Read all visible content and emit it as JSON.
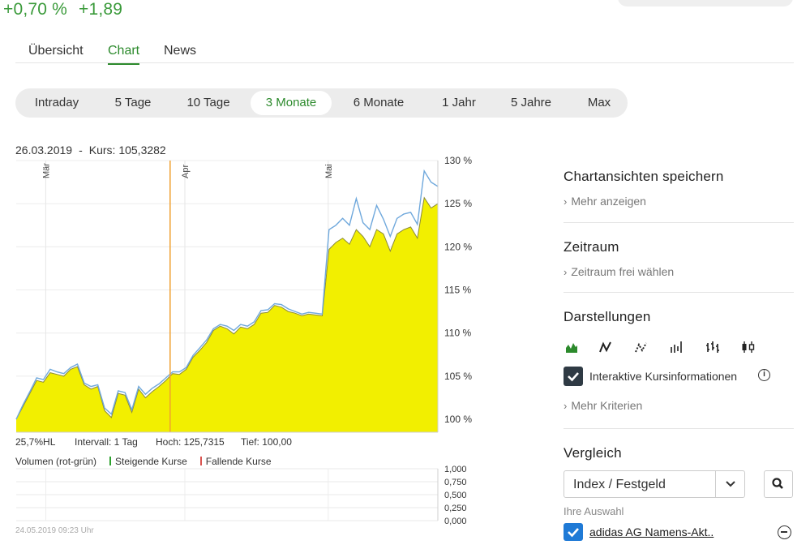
{
  "quote": {
    "change_pct": "+0,70 %",
    "change_abs": "+1,89"
  },
  "tabs": [
    {
      "label": "Übersicht",
      "active": false
    },
    {
      "label": "Chart",
      "active": true
    },
    {
      "label": "News",
      "active": false
    }
  ],
  "ranges": [
    {
      "label": "Intraday",
      "active": false
    },
    {
      "label": "5 Tage",
      "active": false
    },
    {
      "label": "10 Tage",
      "active": false
    },
    {
      "label": "3 Monate",
      "active": true
    },
    {
      "label": "6 Monate",
      "active": false
    },
    {
      "label": "1 Jahr",
      "active": false
    },
    {
      "label": "5 Jahre",
      "active": false
    },
    {
      "label": "Max",
      "active": false
    }
  ],
  "chart_info": {
    "date": "26.03.2019",
    "separator": "-",
    "kurs": "Kurs: 105,3282"
  },
  "stats": {
    "hl": "25,7%HL",
    "interval": "Intervall: 1 Tag",
    "hoch": "Hoch: 125,7315",
    "tief": "Tief: 100,00"
  },
  "volume_legend": {
    "title": "Volumen (rot-grün)",
    "rising": "Steigende Kurse",
    "falling": "Fallende Kurse"
  },
  "timestamp": "24.05.2019 09:23 Uhr",
  "chart_data": [
    {
      "type": "area",
      "x_labels": [
        "Mär",
        "Apr",
        "Mai"
      ],
      "y_ticks": [
        "130 %",
        "125 %",
        "120 %",
        "115 %",
        "110 %",
        "105 %",
        "100 %"
      ],
      "ylim": [
        98.5,
        130
      ],
      "grid": true,
      "crosshair_date": "26.03.2019",
      "month_positions": [
        0.07,
        0.4,
        0.74
      ],
      "crosshair_position": 0.365,
      "series": [
        {
          "values": [
            100.0,
            101.5,
            103.0,
            104.5,
            104.3,
            105.4,
            105.2,
            105.0,
            105.8,
            106.1,
            104.0,
            103.5,
            103.8,
            101.0,
            100.2,
            103.0,
            102.8,
            100.8,
            103.5,
            102.5,
            103.2,
            103.8,
            104.5,
            105.3,
            105.2,
            105.8,
            107.2,
            108.0,
            108.9,
            110.3,
            110.8,
            110.5,
            109.9,
            110.7,
            110.5,
            111.0,
            112.3,
            112.4,
            113.2,
            113.0,
            112.5,
            112.3,
            112.0,
            112.2,
            112.1,
            112.0,
            119.7,
            120.5,
            121.0,
            120.3,
            122.0,
            121.2,
            120.0,
            122.0,
            121.5,
            119.5,
            121.5,
            122.0,
            122.3,
            121.0,
            125.7,
            124.5,
            125.0
          ],
          "color": "#f2ef00"
        },
        {
          "values": [
            100.0,
            101.7,
            103.2,
            104.8,
            104.6,
            105.8,
            105.5,
            105.3,
            106.0,
            106.4,
            104.2,
            103.8,
            104.0,
            101.3,
            100.6,
            103.3,
            103.1,
            101.1,
            103.8,
            102.9,
            103.6,
            104.1,
            104.8,
            105.5,
            105.5,
            106.0,
            107.4,
            108.3,
            109.2,
            110.5,
            111.0,
            110.8,
            110.3,
            111.0,
            110.8,
            111.3,
            112.6,
            112.7,
            113.4,
            113.3,
            112.8,
            112.5,
            112.2,
            112.4,
            112.3,
            112.2,
            122.0,
            122.5,
            123.3,
            122.5,
            125.6,
            122.8,
            122.0,
            124.8,
            123.2,
            121.2,
            123.3,
            123.8,
            124.0,
            122.6,
            128.8,
            127.5,
            127.0
          ],
          "color": "#6fa8dc"
        }
      ]
    },
    {
      "type": "bar",
      "title": "Volumen (rot-grün)",
      "y_ticks": [
        "1,000",
        "0,750",
        "0,500",
        "0,250",
        "0,000"
      ],
      "ylim": [
        0,
        1
      ],
      "grid": true,
      "values": []
    }
  ],
  "panel": {
    "save_title": "Chartansichten speichern",
    "save_more": "Mehr anzeigen",
    "range_title": "Zeitraum",
    "range_free": "Zeitraum frei wählen",
    "display_title": "Darstellungen",
    "view_icons": [
      "area-chart-icon",
      "line-chart-icon",
      "dotted-line-chart-icon",
      "ohlc-bars-icon",
      "hlc-bars-icon",
      "candlestick-icon"
    ],
    "interactive_label": "Interaktive Kursinformationen",
    "more_criteria": "Mehr Kriterien",
    "compare_title": "Vergleich",
    "compare_select": "Index / Festgeld",
    "your_selection": "Ihre Auswahl",
    "selected_item": "adidas AG Namens-Akt..",
    "accent_color": "#2c8a2c",
    "check_color": "#1f7ad6"
  }
}
